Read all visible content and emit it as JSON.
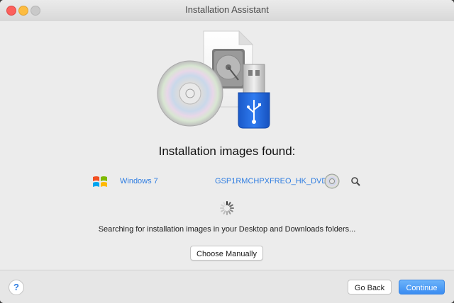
{
  "window": {
    "title": "Installation Assistant"
  },
  "hero": {
    "icons": [
      "dvd-disc-icon",
      "disk-image-file-icon",
      "usb-drive-icon"
    ]
  },
  "main": {
    "heading": "Installation images found:",
    "image": {
      "os_name": "Windows 7",
      "disc_label": "GSP1RMCHPXFREO_HK_DVD",
      "os_icon": "windows-logo-icon",
      "disc_icon": "dvd-disc-icon",
      "action_icon": "magnifier-icon"
    },
    "status_text": "Searching for installation images in your Desktop and Downloads folders...",
    "choose_manually_label": "Choose Manually"
  },
  "footer": {
    "help_label": "?",
    "back_label": "Go Back",
    "continue_label": "Continue"
  },
  "colors": {
    "accent": "#2f7de1",
    "primary_button": "#4a9af4",
    "close": "#fc605c",
    "minimize": "#fdbc40"
  }
}
